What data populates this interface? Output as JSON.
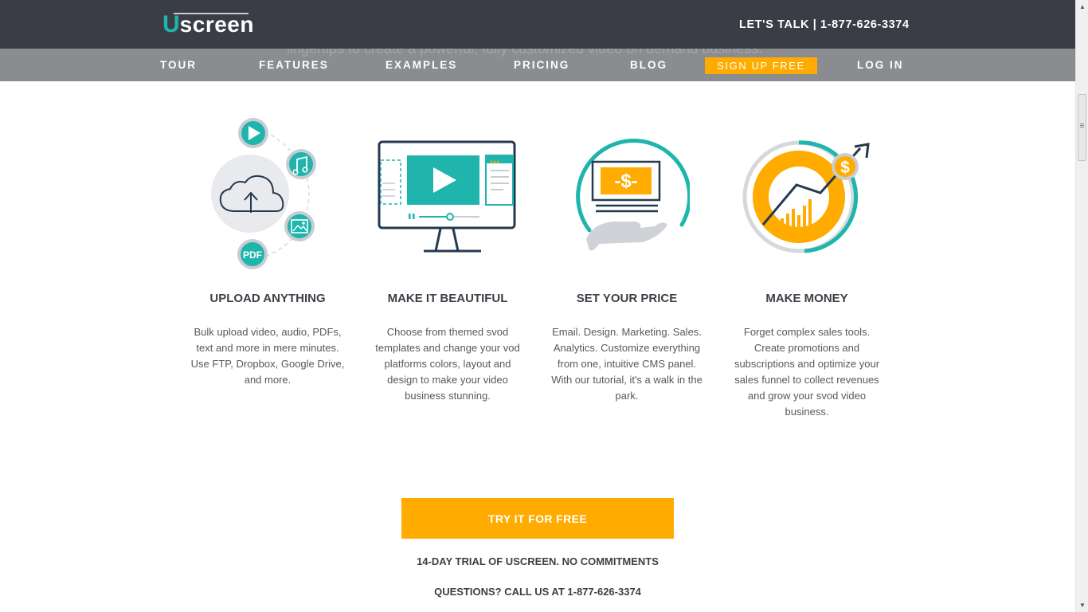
{
  "header": {
    "logo_first": "U",
    "logo_rest": "screen",
    "contact": "LET'S TALK | 1-877-626-3374"
  },
  "nav": {
    "background_text": "lingertips to create a powerful, fully customized video on demand business.",
    "tour": "TOUR",
    "features": "FEATURES",
    "examples": "EXAMPLES",
    "pricing": "PRICING",
    "blog": "BLOG",
    "signup": "SIGN UP FREE",
    "login": "LOG IN"
  },
  "features": [
    {
      "icon": "cloud-upload-icon",
      "title": "UPLOAD ANYTHING",
      "description": "Bulk upload video, audio, PDFs, text and more in mere minutes. Use FTP, Dropbox, Google Drive, and more."
    },
    {
      "icon": "monitor-play-icon",
      "title": "MAKE IT BEAUTIFUL",
      "description": "Choose from themed svod templates and change your vod platforms colors, layout and design to make your video business stunning."
    },
    {
      "icon": "hand-money-icon",
      "title": "SET YOUR PRICE",
      "description": "Email. Design. Marketing. Sales. Analytics. Customize everything from one, intuitive CMS panel. With our tutorial, it's a walk in the park."
    },
    {
      "icon": "growth-chart-icon",
      "title": "MAKE MONEY",
      "description": "Forget complex sales tools. Create promotions and subscriptions and optimize your sales funnel to collect revenues and grow your svod video business."
    }
  ],
  "cta": {
    "button": "TRY IT FOR FREE",
    "trial": "14-DAY TRIAL OF USCREEN. NO COMMITMENTS",
    "questions": "QUESTIONS? CALL US AT 1-877-626-3374"
  },
  "icon_labels": {
    "pdf": "PDF",
    "dollar": "-$-",
    "coin": "$"
  },
  "colors": {
    "header_bg": "#3a3d46",
    "nav_bg": "#8a8c90",
    "accent_orange": "#ffab00",
    "teal": "#1fb5ad",
    "dark_navy": "#243a4f"
  }
}
